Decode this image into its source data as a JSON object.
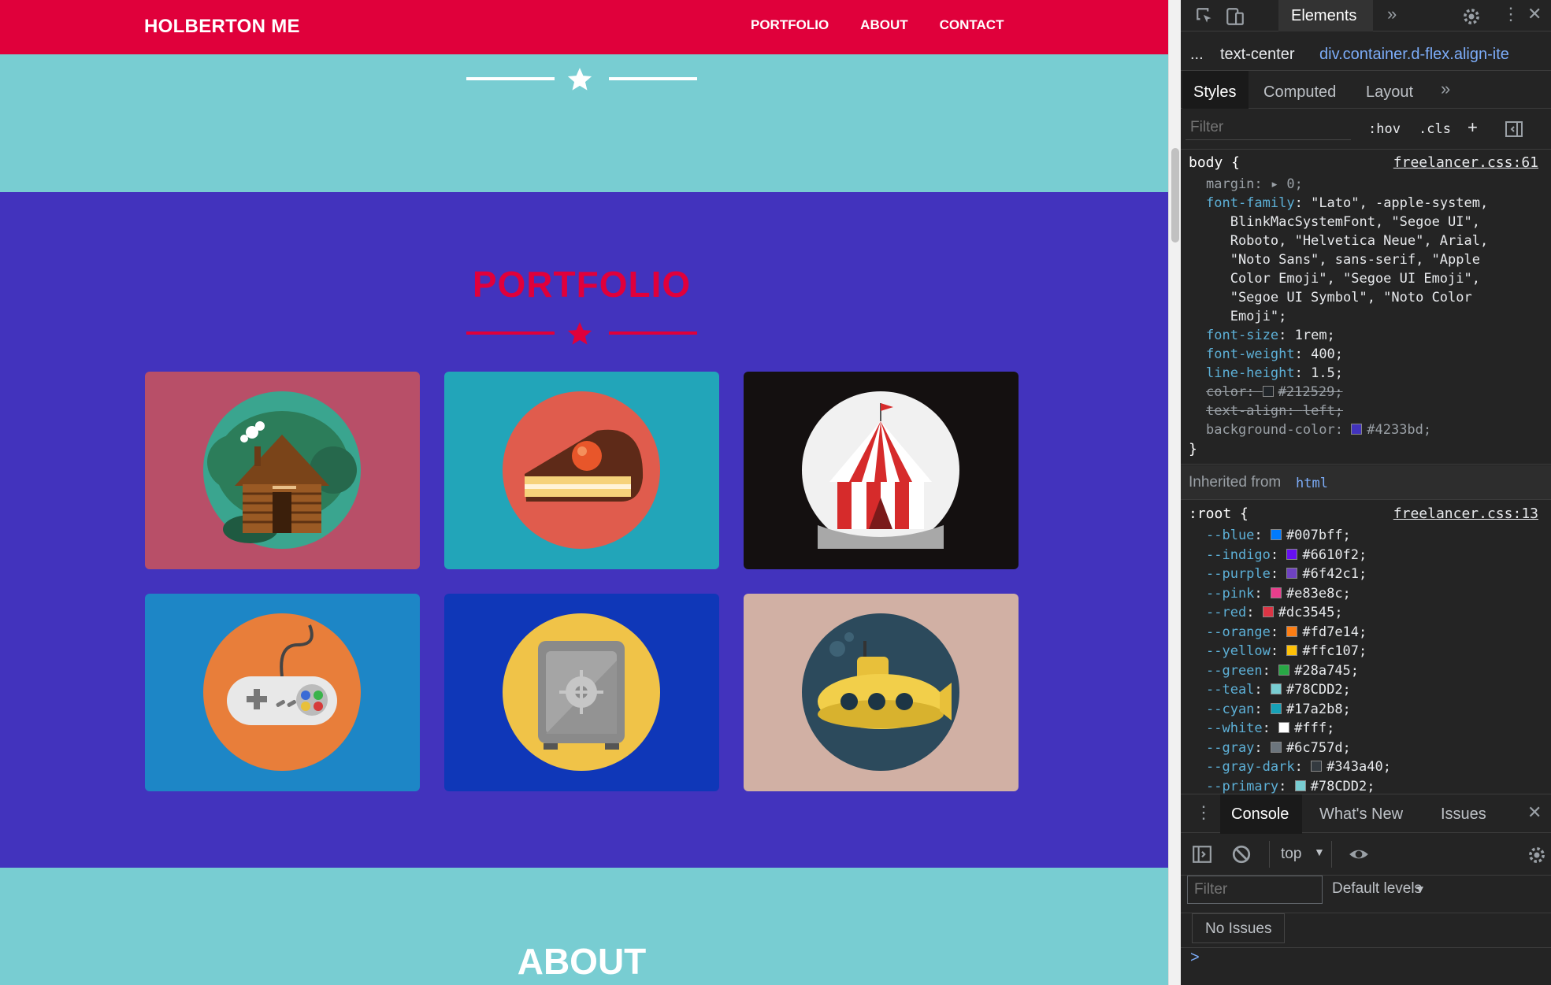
{
  "site": {
    "brand": "HOLBERTON ME",
    "nav": [
      "PORTFOLIO",
      "ABOUT",
      "CONTACT"
    ],
    "portfolio_title": "PORTFOLIO",
    "about_title": "ABOUT",
    "colors": {
      "red": "#e0003b",
      "teal": "#78cdd2",
      "indigo": "#4233bd"
    },
    "cards": [
      {
        "name": "cabin",
        "bg": "#b84f68"
      },
      {
        "name": "cake",
        "bg": "#22a5b9"
      },
      {
        "name": "circus",
        "bg": "#141010"
      },
      {
        "name": "controller",
        "bg": "#1d86c6"
      },
      {
        "name": "safe",
        "bg": "#0f37b8"
      },
      {
        "name": "submarine",
        "bg": "#d1b0a4"
      }
    ]
  },
  "devtools": {
    "top_tabs": [
      "Elements"
    ],
    "breadcrumb": [
      "...",
      "text-center",
      "div.container.d-flex.align-ite"
    ],
    "subtabs": [
      "Styles",
      "Computed",
      "Layout"
    ],
    "filter_placeholder": "Filter",
    "hov": ":hov",
    "cls": ".cls",
    "body_rule": {
      "selector": "body {",
      "source": "freelancer.css:61",
      "lines": [
        {
          "prop": "margin",
          "value": "0;",
          "style": "dim"
        },
        {
          "prop": "font-family",
          "value": "\"Lato\", -apple-system,"
        },
        {
          "text": "   BlinkMacSystemFont, \"Segoe UI\","
        },
        {
          "text": "   Roboto, \"Helvetica Neue\", Arial,"
        },
        {
          "text": "   \"Noto Sans\", sans-serif, \"Apple"
        },
        {
          "text": "   Color Emoji\", \"Segoe UI Emoji\","
        },
        {
          "text": "   \"Segoe UI Symbol\", \"Noto Color"
        },
        {
          "text": "   Emoji\";"
        },
        {
          "prop": "font-size",
          "value": "1rem;"
        },
        {
          "prop": "font-weight",
          "value": "400;"
        },
        {
          "prop": "line-height",
          "value": "1.5;"
        },
        {
          "prop": "color",
          "value": "#212529;",
          "style": "strike",
          "swatch": "#212529"
        },
        {
          "prop": "text-align",
          "value": "left;",
          "style": "strike"
        },
        {
          "prop": "background-color",
          "value": "#4233bd;",
          "style": "dim",
          "swatch": "#4233bd"
        }
      ],
      "close": "}"
    },
    "inherited_label": "Inherited from",
    "inherited_from": "html",
    "root_rule": {
      "selector": ":root {",
      "source": "freelancer.css:13",
      "vars": [
        {
          "name": "--blue",
          "value": "#007bff;",
          "swatch": "#007bff"
        },
        {
          "name": "--indigo",
          "value": "#6610f2;",
          "swatch": "#6610f2"
        },
        {
          "name": "--purple",
          "value": "#6f42c1;",
          "swatch": "#6f42c1"
        },
        {
          "name": "--pink",
          "value": "#e83e8c;",
          "swatch": "#e83e8c"
        },
        {
          "name": "--red",
          "value": "#dc3545;",
          "swatch": "#dc3545"
        },
        {
          "name": "--orange",
          "value": "#fd7e14;",
          "swatch": "#fd7e14"
        },
        {
          "name": "--yellow",
          "value": "#ffc107;",
          "swatch": "#ffc107"
        },
        {
          "name": "--green",
          "value": "#28a745;",
          "swatch": "#28a745"
        },
        {
          "name": "--teal",
          "value": "#78CDD2;",
          "swatch": "#78CDD2"
        },
        {
          "name": "--cyan",
          "value": "#17a2b8;",
          "swatch": "#17a2b8"
        },
        {
          "name": "--white",
          "value": "#fff;",
          "swatch": "#ffffff"
        },
        {
          "name": "--gray",
          "value": "#6c757d;",
          "swatch": "#6c757d"
        },
        {
          "name": "--gray-dark",
          "value": "#343a40;",
          "swatch": "#343a40"
        },
        {
          "name": "--primary",
          "value": "#78CDD2;",
          "swatch": "#78CDD2"
        }
      ]
    },
    "drawer_tabs": [
      "Console",
      "What's New",
      "Issues"
    ],
    "context": "top",
    "console_filter_placeholder": "Filter",
    "levels": "Default levels",
    "no_issues": "No Issues",
    "prompt": ">"
  }
}
